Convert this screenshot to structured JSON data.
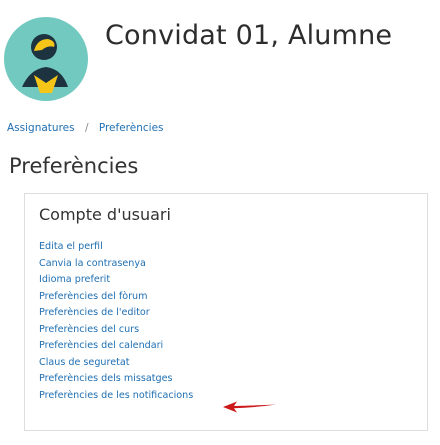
{
  "user": {
    "name": "Convidat 01, Alumne",
    "avatar_icon": "user-avatar-icon",
    "avatar_colors": {
      "background": "#71c9bf",
      "figure": "#1d3440",
      "accent": "#f5c518"
    }
  },
  "breadcrumb": {
    "items": [
      "Assignatures",
      "Preferències"
    ],
    "separator": "/"
  },
  "page_title": "Preferències",
  "account_card": {
    "title": "Compte d'usuari",
    "links": [
      "Edita el perfil",
      "Canvia la contrasenya",
      "Idioma preferit",
      "Preferències del fòrum",
      "Preferències de l'editor",
      "Preferències del curs",
      "Preferències del calendari",
      "Claus de seguretat",
      "Preferències dels missatges",
      "Preferències de les notificacions"
    ]
  },
  "annotation": {
    "icon": "red-arrow-icon",
    "color": "#cc1a1a"
  },
  "colors": {
    "link": "#1f6fb2",
    "text": "#333333",
    "border": "#dedede"
  }
}
